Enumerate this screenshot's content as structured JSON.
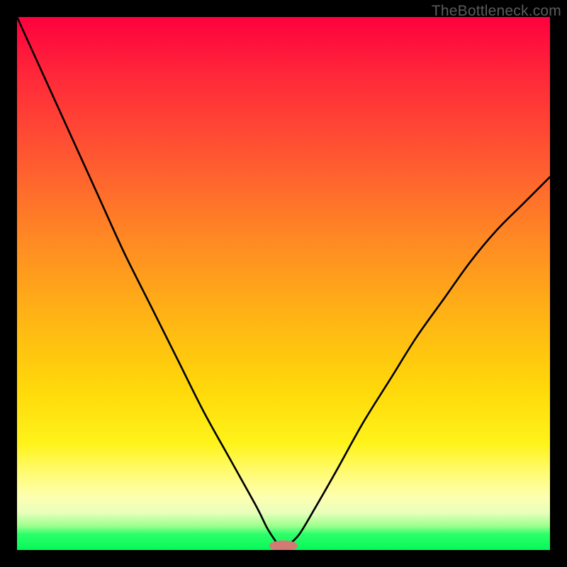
{
  "watermark": "TheBottleneck.com",
  "chart_data": {
    "type": "line",
    "title": "",
    "xlabel": "",
    "ylabel": "",
    "xlim": [
      0,
      100
    ],
    "ylim": [
      0,
      100
    ],
    "grid": false,
    "legend": false,
    "gradient_stops": [
      {
        "pos": 0,
        "color": "#fe013e"
      },
      {
        "pos": 12,
        "color": "#ff2b39"
      },
      {
        "pos": 28,
        "color": "#ff5d30"
      },
      {
        "pos": 42,
        "color": "#ff8a23"
      },
      {
        "pos": 56,
        "color": "#ffb315"
      },
      {
        "pos": 70,
        "color": "#ffd90a"
      },
      {
        "pos": 80,
        "color": "#fff31a"
      },
      {
        "pos": 86,
        "color": "#fffc7a"
      },
      {
        "pos": 90,
        "color": "#fdffb0"
      },
      {
        "pos": 93,
        "color": "#e8ffbb"
      },
      {
        "pos": 95.5,
        "color": "#9cff8e"
      },
      {
        "pos": 97,
        "color": "#2dff6a"
      },
      {
        "pos": 100,
        "color": "#06f85a"
      }
    ],
    "series": [
      {
        "name": "bottleneck-curve",
        "x": [
          0.0,
          5,
          10,
          15,
          20,
          25,
          30,
          35,
          40,
          45,
          47,
          49,
          50,
          51,
          53,
          56,
          60,
          65,
          70,
          75,
          80,
          85,
          90,
          95,
          100
        ],
        "y": [
          100,
          89,
          78,
          67,
          56,
          46,
          36,
          26,
          17,
          8,
          4,
          1,
          0,
          1,
          3,
          8,
          15,
          24,
          32,
          40,
          47,
          54,
          60,
          65,
          70
        ]
      }
    ],
    "marker": {
      "x": 50,
      "y": 0.8,
      "rx": 2.7,
      "ry": 1.0,
      "color": "#d47a74"
    }
  }
}
